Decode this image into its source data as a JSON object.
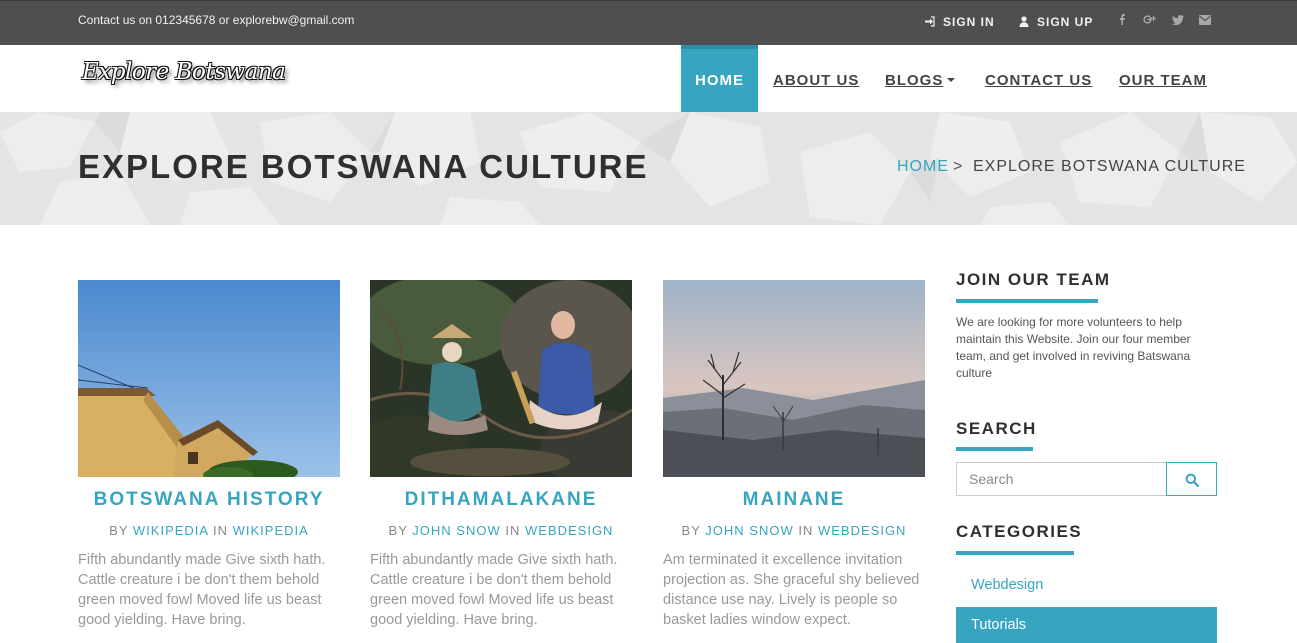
{
  "topbar": {
    "contact_text": "Contact us on 012345678 or explorebw@gmail.com",
    "sign_in": "SIGN IN",
    "sign_up": "SIGN UP",
    "social_icons": [
      "facebook-icon",
      "google-plus-icon",
      "twitter-icon",
      "envelope-icon"
    ]
  },
  "header": {
    "logo_text": "Explore Botswana",
    "nav": [
      "HOME",
      "ABOUT US",
      "BLOGS",
      "CONTACT US",
      "OUR TEAM"
    ],
    "active_nav": "HOME"
  },
  "banner": {
    "title": "EXPLORE BOTSWANA CULTURE",
    "breadcrumb_home": "HOME",
    "breadcrumb_sep": ">",
    "breadcrumb_current": "EXPLORE BOTSWANA CULTURE"
  },
  "cards": [
    {
      "title": "BOTSWANA HISTORY",
      "by": "BY",
      "author": "WIKIPEDIA",
      "in": "IN",
      "category": "WIKIPEDIA",
      "excerpt": "Fifth abundantly made Give sixth hath. Cattle creature i be don't them behold green moved fowl Moved life us beast good yielding. Have bring."
    },
    {
      "title": "DITHAMALAKANE",
      "by": "BY",
      "author": "JOHN SNOW",
      "in": "IN",
      "category": "WEBDESIGN",
      "excerpt": "Fifth abundantly made Give sixth hath. Cattle creature i be don't them behold green moved fowl Moved life us beast good yielding. Have bring."
    },
    {
      "title": "MAINANE",
      "by": "BY",
      "author": "JOHN SNOW",
      "in": "IN",
      "category": "WEBDESIGN",
      "excerpt": "Am terminated it excellence invitation projection as. She graceful shy believed distance use nay. Lively is people so basket ladies window expect."
    }
  ],
  "sidebar": {
    "join_title": "JOIN OUR TEAM",
    "join_text": "We are looking for more volunteers to help maintain this Website. Join our four member team, and get involved in reviving Batswana culture",
    "search_title": "SEARCH",
    "search_placeholder": "Search",
    "categories_title": "CATEGORIES",
    "categories": [
      "Webdesign",
      "Tutorials"
    ],
    "active_category": "Tutorials"
  },
  "colors": {
    "accent": "#37a5c0",
    "topbar_bg": "#4f4f4f",
    "banner_bg": "#e4e4e4"
  }
}
